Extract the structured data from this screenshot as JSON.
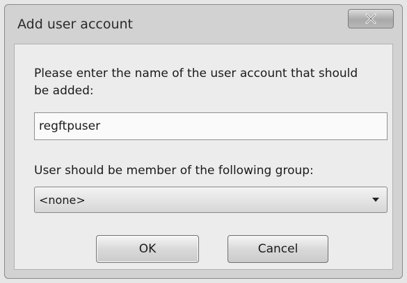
{
  "window": {
    "title": "Add user account",
    "close_icon": "close-icon"
  },
  "form": {
    "prompt": "Please enter the name of the user account that should be added:",
    "username_value": "regftpuser",
    "group_label": "User should be member of the following group:",
    "group_selected": "<none>"
  },
  "buttons": {
    "ok_label": "OK",
    "cancel_label": "Cancel"
  }
}
